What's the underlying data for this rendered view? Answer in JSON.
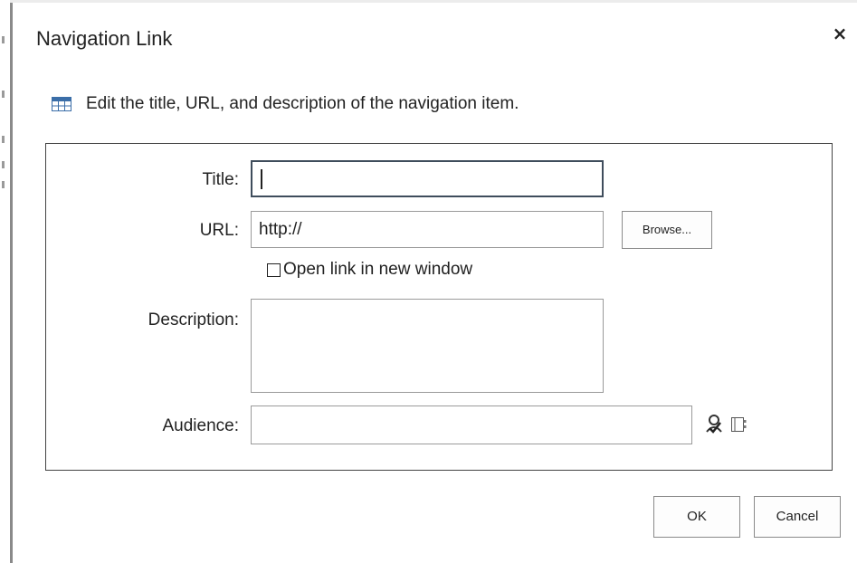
{
  "dialog": {
    "title": "Navigation Link",
    "close_label": "×",
    "instruction": "Edit the title, URL, and description of the navigation item."
  },
  "icons": {
    "instruction": "table-icon",
    "check_names": "check-names-icon",
    "browse_audience": "address-book-icon",
    "close": "close-icon"
  },
  "form": {
    "title_label": "Title:",
    "title_value": "",
    "url_label": "URL:",
    "url_value": "http://",
    "browse_label": "Browse...",
    "open_new_window_label": "Open link in new window",
    "open_new_window_checked": false,
    "description_label": "Description:",
    "description_value": "",
    "audience_label": "Audience:",
    "audience_value": ""
  },
  "buttons": {
    "ok": "OK",
    "cancel": "Cancel"
  }
}
